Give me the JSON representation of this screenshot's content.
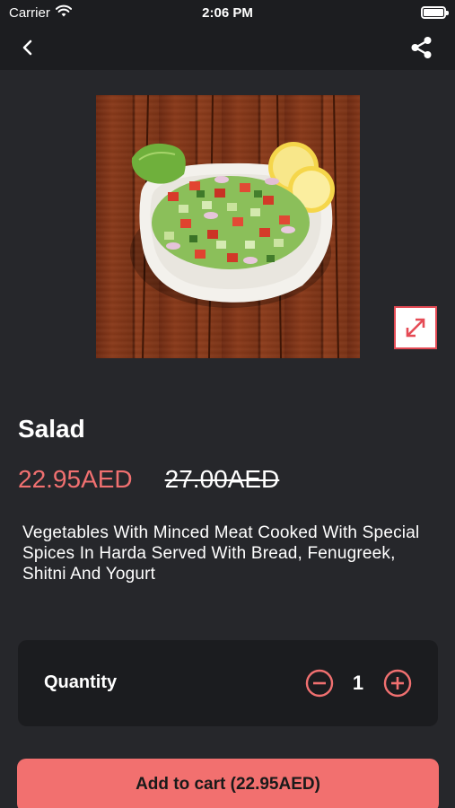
{
  "status_bar": {
    "carrier": "Carrier",
    "time": "2:06 PM",
    "icons": [
      "wifi-icon",
      "battery-icon"
    ]
  },
  "nav": {
    "back_icon": "chevron-left-icon",
    "share_icon": "share-icon"
  },
  "product": {
    "title": "Salad",
    "price": "22.95AED",
    "original_price": "27.00AED",
    "description": "Vegetables With Minced Meat Cooked With Special Spices In Harda Served With Bread, Fenugreek, Shitni And Yogurt",
    "image": "salad-photo",
    "expand_icon": "expand-icon"
  },
  "quantity": {
    "label": "Quantity",
    "value": "1",
    "minus_icon": "minus-circle-icon",
    "plus_icon": "plus-circle-icon"
  },
  "cart": {
    "label": "Add to cart (22.95AED)"
  },
  "colors": {
    "background": "#26272b",
    "bar": "#1c1d20",
    "accent": "#f2706f",
    "price": "#f07070",
    "card": "#1b1c1f"
  }
}
